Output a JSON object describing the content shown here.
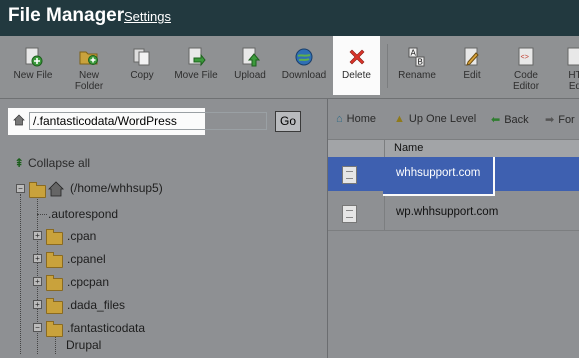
{
  "header": {
    "title": "File Manager",
    "settings_link": "Settings"
  },
  "toolbar": {
    "new_file": "New File",
    "new_folder": "New Folder",
    "copy": "Copy",
    "move_file": "Move File",
    "upload": "Upload",
    "download": "Download",
    "delete": "Delete",
    "rename": "Rename",
    "edit": "Edit",
    "code_editor": "Code Editor",
    "html_editor": "HT Ed"
  },
  "pathbar": {
    "path_value": "/.fantasticodata/WordPress",
    "go_label": "Go"
  },
  "tree": {
    "collapse_all": "Collapse all",
    "root": "(/home/whhsup5)",
    "items": [
      ".autorespond",
      ".cpan",
      ".cpanel",
      ".cpcpan",
      ".dada_files",
      ".fantasticodata",
      "Drupal"
    ]
  },
  "nav": {
    "home": "Home",
    "up_one_level": "Up One Level",
    "back": "Back",
    "forward": "For"
  },
  "table": {
    "column_name": "Name",
    "rows": [
      "whhsupport.com",
      "wp.whhsupport.com"
    ]
  },
  "colors": {
    "header_bg": "#22393f",
    "selected_row": "#3e60b0",
    "delete_icon": "#d9342a"
  }
}
